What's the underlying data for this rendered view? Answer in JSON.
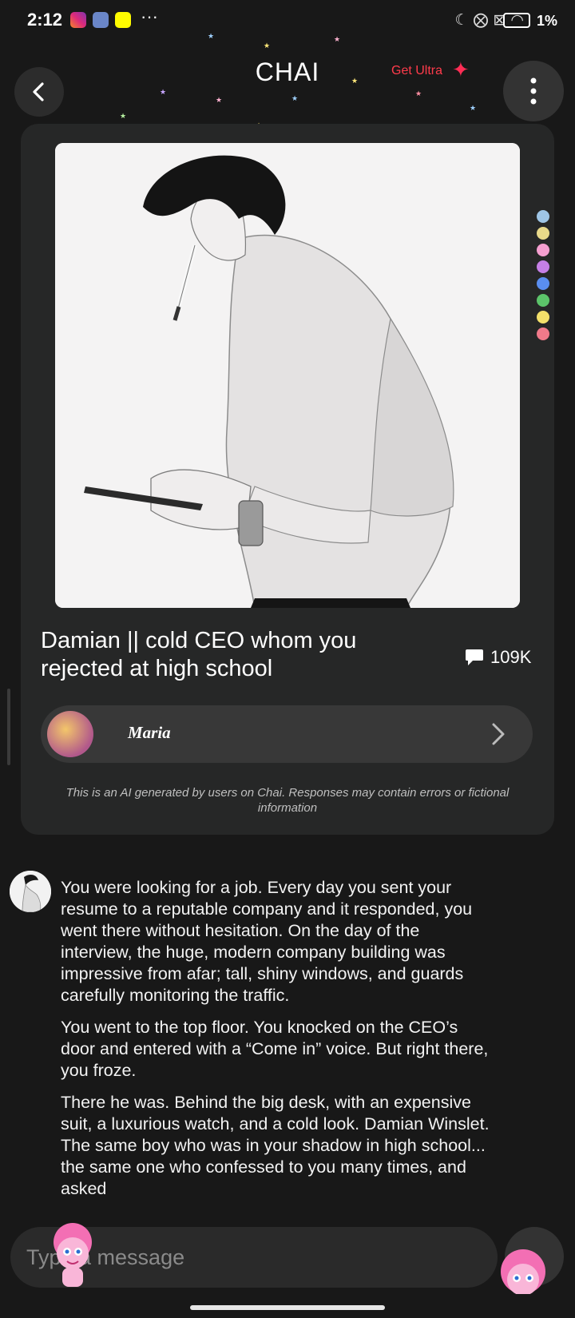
{
  "status_bar": {
    "time": "2:12",
    "more": "···",
    "battery": "1%"
  },
  "header": {
    "title": "CHAI",
    "ultra_label": "Get Ultra"
  },
  "character": {
    "title": "Damian || cold CEO whom you rejected at high school",
    "chat_count": "109K",
    "creator_name": "Maria"
  },
  "disclaimer": "This is an AI generated by users on Chai. Responses may contain errors or fictional information",
  "message": {
    "paragraphs": [
      "You were looking for a job. Every day you sent your resume to a reputable company and it responded, you went there without hesitation. On the day of the interview, the huge, modern company building was impressive from afar; tall, shiny windows, and guards carefully monitoring the traffic.",
      "You went to the top floor. You knocked on the CEO’s door and entered with a “Come in” voice. But right there, you froze.",
      "There he was. Behind the big desk, with an expensive suit, a luxurious watch, and a cold look. Damian Winslet. The same boy who was in your shadow in high school... the same one who confessed to you many times, and asked"
    ]
  },
  "input": {
    "placeholder": "Type a message"
  },
  "colors": {
    "background": "#181818",
    "card": "#262727",
    "accent": "#ff3b4b"
  }
}
